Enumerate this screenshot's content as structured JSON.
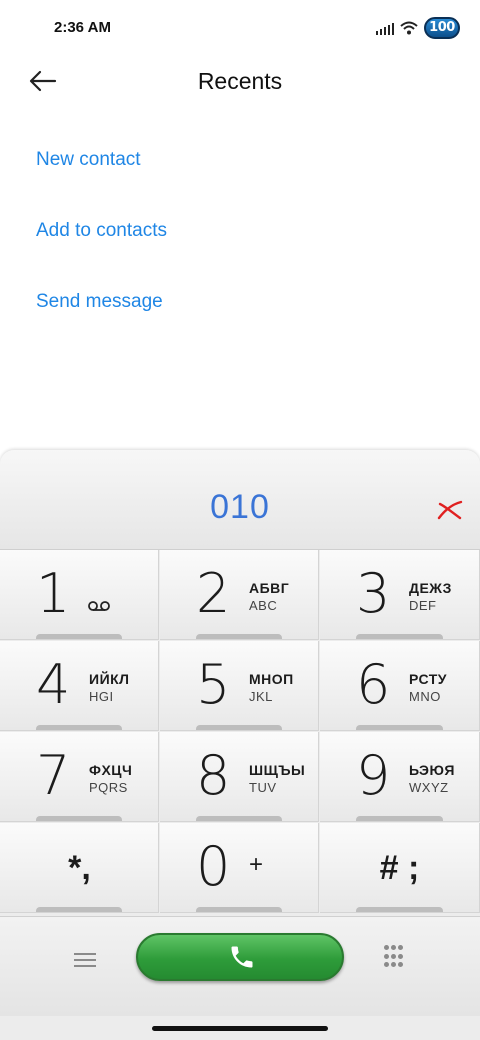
{
  "status": {
    "time": "2:36 AM",
    "battery": "100",
    "icons": [
      "signal-icon",
      "wifi-icon",
      "battery-icon"
    ]
  },
  "header": {
    "title": "Recents",
    "back_icon": "arrow-left-icon"
  },
  "actions": [
    {
      "label": "New contact"
    },
    {
      "label": "Add to contacts"
    },
    {
      "label": "Send message"
    }
  ],
  "dialer": {
    "number": "010",
    "delete_icon": "backspace-x-icon",
    "keys": [
      {
        "digit": "1",
        "cyr": "",
        "lat": "",
        "sym": "voicemail-icon"
      },
      {
        "digit": "2",
        "cyr": "АБВГ",
        "lat": "ABC"
      },
      {
        "digit": "3",
        "cyr": "ДЕЖЗ",
        "lat": "DEF"
      },
      {
        "digit": "4",
        "cyr": "ИЙКЛ",
        "lat": "HGI"
      },
      {
        "digit": "5",
        "cyr": "МНОП",
        "lat": "JKL"
      },
      {
        "digit": "6",
        "cyr": "РСТУ",
        "lat": "MNO"
      },
      {
        "digit": "7",
        "cyr": "ФХЦЧ",
        "lat": "PQRS"
      },
      {
        "digit": "8",
        "cyr": "ШЩЪЫ",
        "lat": "TUV"
      },
      {
        "digit": "9",
        "cyr": "ЬЭЮЯ",
        "lat": "WXYZ"
      },
      {
        "sym": "*,"
      },
      {
        "digit": "0",
        "plus": "+"
      },
      {
        "sym": "# ;"
      }
    ]
  },
  "bottom": {
    "menu_icon": "menu-icon",
    "call_icon": "phone-icon",
    "keypad_icon": "dialpad-icon"
  },
  "colors": {
    "accent": "#1f86e5",
    "number": "#3a74d6",
    "call": "#2e9c3a",
    "delete": "#e02020"
  }
}
